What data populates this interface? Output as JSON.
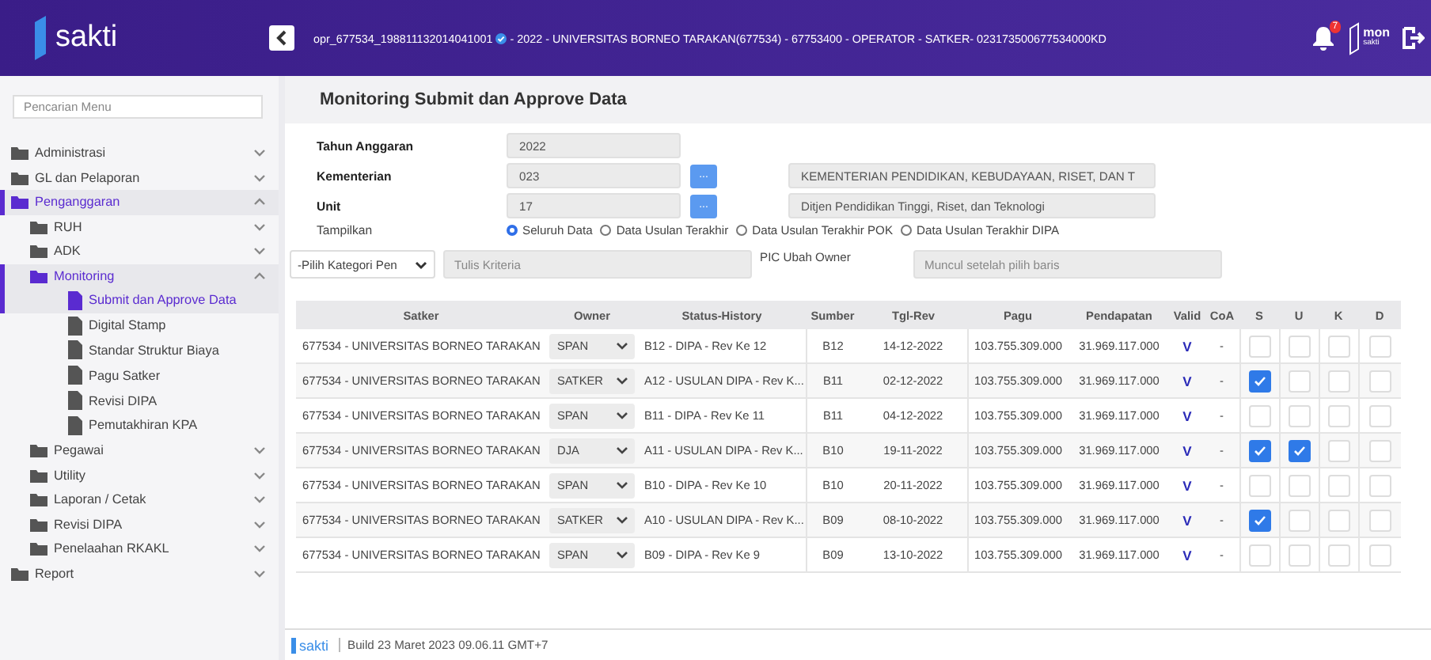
{
  "topbar": {
    "logo": "sakti",
    "user": "opr_677534_198811132014041001",
    "info": " - 2022 - UNIVERSITAS BORNEO TARAKAN(677534) - 67753400 - OPERATOR - SATKER- 023173500677534000KD",
    "notification_count": "7",
    "brand_top": "mon",
    "brand_bottom": "sakti"
  },
  "sidebar": {
    "search": {
      "placeholder": "Pencarian Menu"
    },
    "items": [
      {
        "label": "Administrasi",
        "kind": "folder",
        "expanded": false,
        "selected": false
      },
      {
        "label": "GL dan Pelaporan",
        "kind": "folder",
        "expanded": false,
        "selected": false
      },
      {
        "label": "Penganggaran",
        "kind": "folder",
        "expanded": true,
        "selected": true,
        "children": [
          {
            "label": "RUH",
            "kind": "folder",
            "expanded": false,
            "selected": false
          },
          {
            "label": "ADK",
            "kind": "folder",
            "expanded": false,
            "selected": false
          },
          {
            "label": "Monitoring",
            "kind": "folder",
            "expanded": true,
            "selected": true,
            "children": [
              {
                "label": "Submit dan Approve Data",
                "kind": "page",
                "selected": true
              },
              {
                "label": "Digital Stamp",
                "kind": "page",
                "selected": false
              },
              {
                "label": "Standar Struktur Biaya",
                "kind": "page",
                "selected": false
              },
              {
                "label": "Pagu Satker",
                "kind": "page",
                "selected": false
              },
              {
                "label": "Revisi DIPA",
                "kind": "page",
                "selected": false
              },
              {
                "label": "Pemutakhiran KPA",
                "kind": "page",
                "selected": false
              }
            ]
          },
          {
            "label": "Pegawai",
            "kind": "folder",
            "expanded": false,
            "selected": false
          },
          {
            "label": "Utility",
            "kind": "folder",
            "expanded": false,
            "selected": false
          },
          {
            "label": "Laporan / Cetak",
            "kind": "folder",
            "expanded": false,
            "selected": false
          },
          {
            "label": "Revisi DIPA",
            "kind": "folder",
            "expanded": false,
            "selected": false
          },
          {
            "label": "Penelaahan RKAKL",
            "kind": "folder",
            "expanded": false,
            "selected": false
          }
        ]
      },
      {
        "label": "Report",
        "kind": "folder",
        "expanded": false,
        "selected": false
      }
    ]
  },
  "page_title": "Monitoring Submit dan Approve Data",
  "form": {
    "tahun": {
      "label": "Tahun Anggaran",
      "value": "2022"
    },
    "kementerian": {
      "label": "Kementerian",
      "code": "023",
      "name": "KEMENTERIAN PENDIDIKAN, KEBUDAYAAN, RISET, DAN T"
    },
    "unit": {
      "label": "Unit",
      "code": "17",
      "name": "Ditjen Pendidikan Tinggi, Riset, dan Teknologi"
    },
    "lookup_button": "...",
    "tampilkan": {
      "label": "Tampilkan",
      "options": [
        {
          "label": "Seluruh Data",
          "selected": true
        },
        {
          "label": "Data Usulan Terakhir",
          "selected": false
        },
        {
          "label": "Data Usulan Terakhir POK",
          "selected": false
        },
        {
          "label": "Data Usulan Terakhir DIPA",
          "selected": false
        }
      ]
    }
  },
  "filter": {
    "category": "-Pilih Kategori Pen",
    "criteria": {
      "placeholder": "Tulis Kriteria"
    },
    "pic_label": "PIC Ubah Owner",
    "pic": {
      "placeholder": "Muncul setelah pilih baris"
    }
  },
  "table": {
    "columns": [
      "Satker",
      "Owner",
      "Status-History",
      "Sumber",
      "Tgl-Rev",
      "Pagu",
      "Pendapatan",
      "Valid",
      "CoA",
      "S",
      "U",
      "K",
      "D"
    ],
    "rows": [
      {
        "satker": "677534 - UNIVERSITAS BORNEO TARAKAN",
        "owner": "SPAN",
        "status": "B12 - DIPA - Rev Ke 12",
        "sumber": "B12",
        "tgl": "14-12-2022",
        "pagu": "103.755.309.000",
        "pendapatan": "31.969.117.000",
        "valid": "V",
        "coa": "-",
        "s": false,
        "u": false,
        "k": false,
        "d": false
      },
      {
        "satker": "677534 - UNIVERSITAS BORNEO TARAKAN",
        "owner": "SATKER",
        "status": "A12 - USULAN DIPA - Rev K...",
        "sumber": "B11",
        "tgl": "02-12-2022",
        "pagu": "103.755.309.000",
        "pendapatan": "31.969.117.000",
        "valid": "V",
        "coa": "-",
        "s": true,
        "u": false,
        "k": false,
        "d": false
      },
      {
        "satker": "677534 - UNIVERSITAS BORNEO TARAKAN",
        "owner": "SPAN",
        "status": "B11 - DIPA - Rev Ke 11",
        "sumber": "B11",
        "tgl": "04-12-2022",
        "pagu": "103.755.309.000",
        "pendapatan": "31.969.117.000",
        "valid": "V",
        "coa": "-",
        "s": false,
        "u": false,
        "k": false,
        "d": false
      },
      {
        "satker": "677534 - UNIVERSITAS BORNEO TARAKAN",
        "owner": "DJA",
        "status": "A11 - USULAN DIPA - Rev K...",
        "sumber": "B10",
        "tgl": "19-11-2022",
        "pagu": "103.755.309.000",
        "pendapatan": "31.969.117.000",
        "valid": "V",
        "coa": "-",
        "s": true,
        "u": true,
        "k": false,
        "d": false
      },
      {
        "satker": "677534 - UNIVERSITAS BORNEO TARAKAN",
        "owner": "SPAN",
        "status": "B10 - DIPA - Rev Ke 10",
        "sumber": "B10",
        "tgl": "20-11-2022",
        "pagu": "103.755.309.000",
        "pendapatan": "31.969.117.000",
        "valid": "V",
        "coa": "-",
        "s": false,
        "u": false,
        "k": false,
        "d": false
      },
      {
        "satker": "677534 - UNIVERSITAS BORNEO TARAKAN",
        "owner": "SATKER",
        "status": "A10 - USULAN DIPA - Rev K...",
        "sumber": "B09",
        "tgl": "08-10-2022",
        "pagu": "103.755.309.000",
        "pendapatan": "31.969.117.000",
        "valid": "V",
        "coa": "-",
        "s": true,
        "u": false,
        "k": false,
        "d": false
      },
      {
        "satker": "677534 - UNIVERSITAS BORNEO TARAKAN",
        "owner": "SPAN",
        "status": "B09 - DIPA - Rev Ke 9",
        "sumber": "B09",
        "tgl": "13-10-2022",
        "pagu": "103.755.309.000",
        "pendapatan": "31.969.117.000",
        "valid": "V",
        "coa": "-",
        "s": false,
        "u": false,
        "k": false,
        "d": false
      }
    ]
  },
  "footer": {
    "logo": "sakti",
    "build": "Build 23 Maret 2023 09.06.11 GMT+7"
  }
}
